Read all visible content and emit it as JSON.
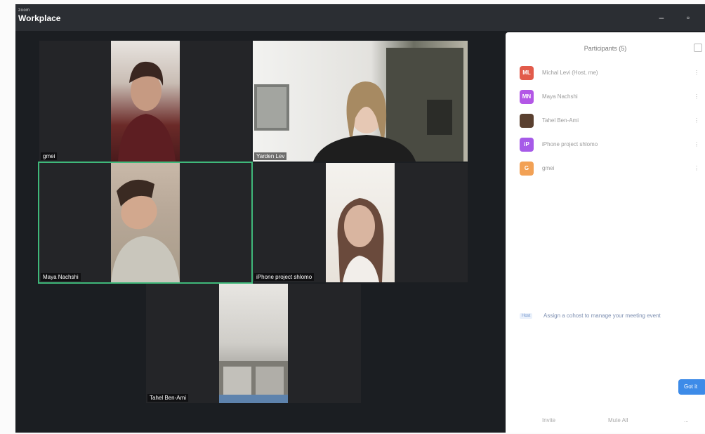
{
  "app": {
    "title_small": "zoom",
    "title": "Workplace"
  },
  "window_controls": {
    "minimize": "–",
    "restore": "▫"
  },
  "colors": {
    "accent": "#3fb87a",
    "panel_button": "#3d8be8"
  },
  "video_tiles": [
    {
      "name": "gmei"
    },
    {
      "name": "Yarden Lev"
    },
    {
      "name": "Maya Nachshi"
    },
    {
      "name": "iPhone project shlomo"
    },
    {
      "name": "Tahel Ben-Ami"
    }
  ],
  "participants": {
    "title": "Participants (5)",
    "items": [
      {
        "initials": "ML",
        "name": "Michal Levi (Host, me)",
        "color": "#e25b4b"
      },
      {
        "initials": "MN",
        "name": "Maya Nachshi",
        "color": "#b357e6"
      },
      {
        "initials": "",
        "name": "Tahel Ben-Ami",
        "color": "#5a4030"
      },
      {
        "initials": "iP",
        "name": "iPhone project shlomo",
        "color": "#a65ae8"
      },
      {
        "initials": "G",
        "name": "gmei",
        "color": "#f2a155"
      }
    ]
  },
  "notice": {
    "tag": "Host",
    "text": "Assign a cohost to manage your meeting event"
  },
  "footer": {
    "invite": "Invite",
    "mute_all": "Mute All",
    "more": "...",
    "action": "Got it"
  }
}
